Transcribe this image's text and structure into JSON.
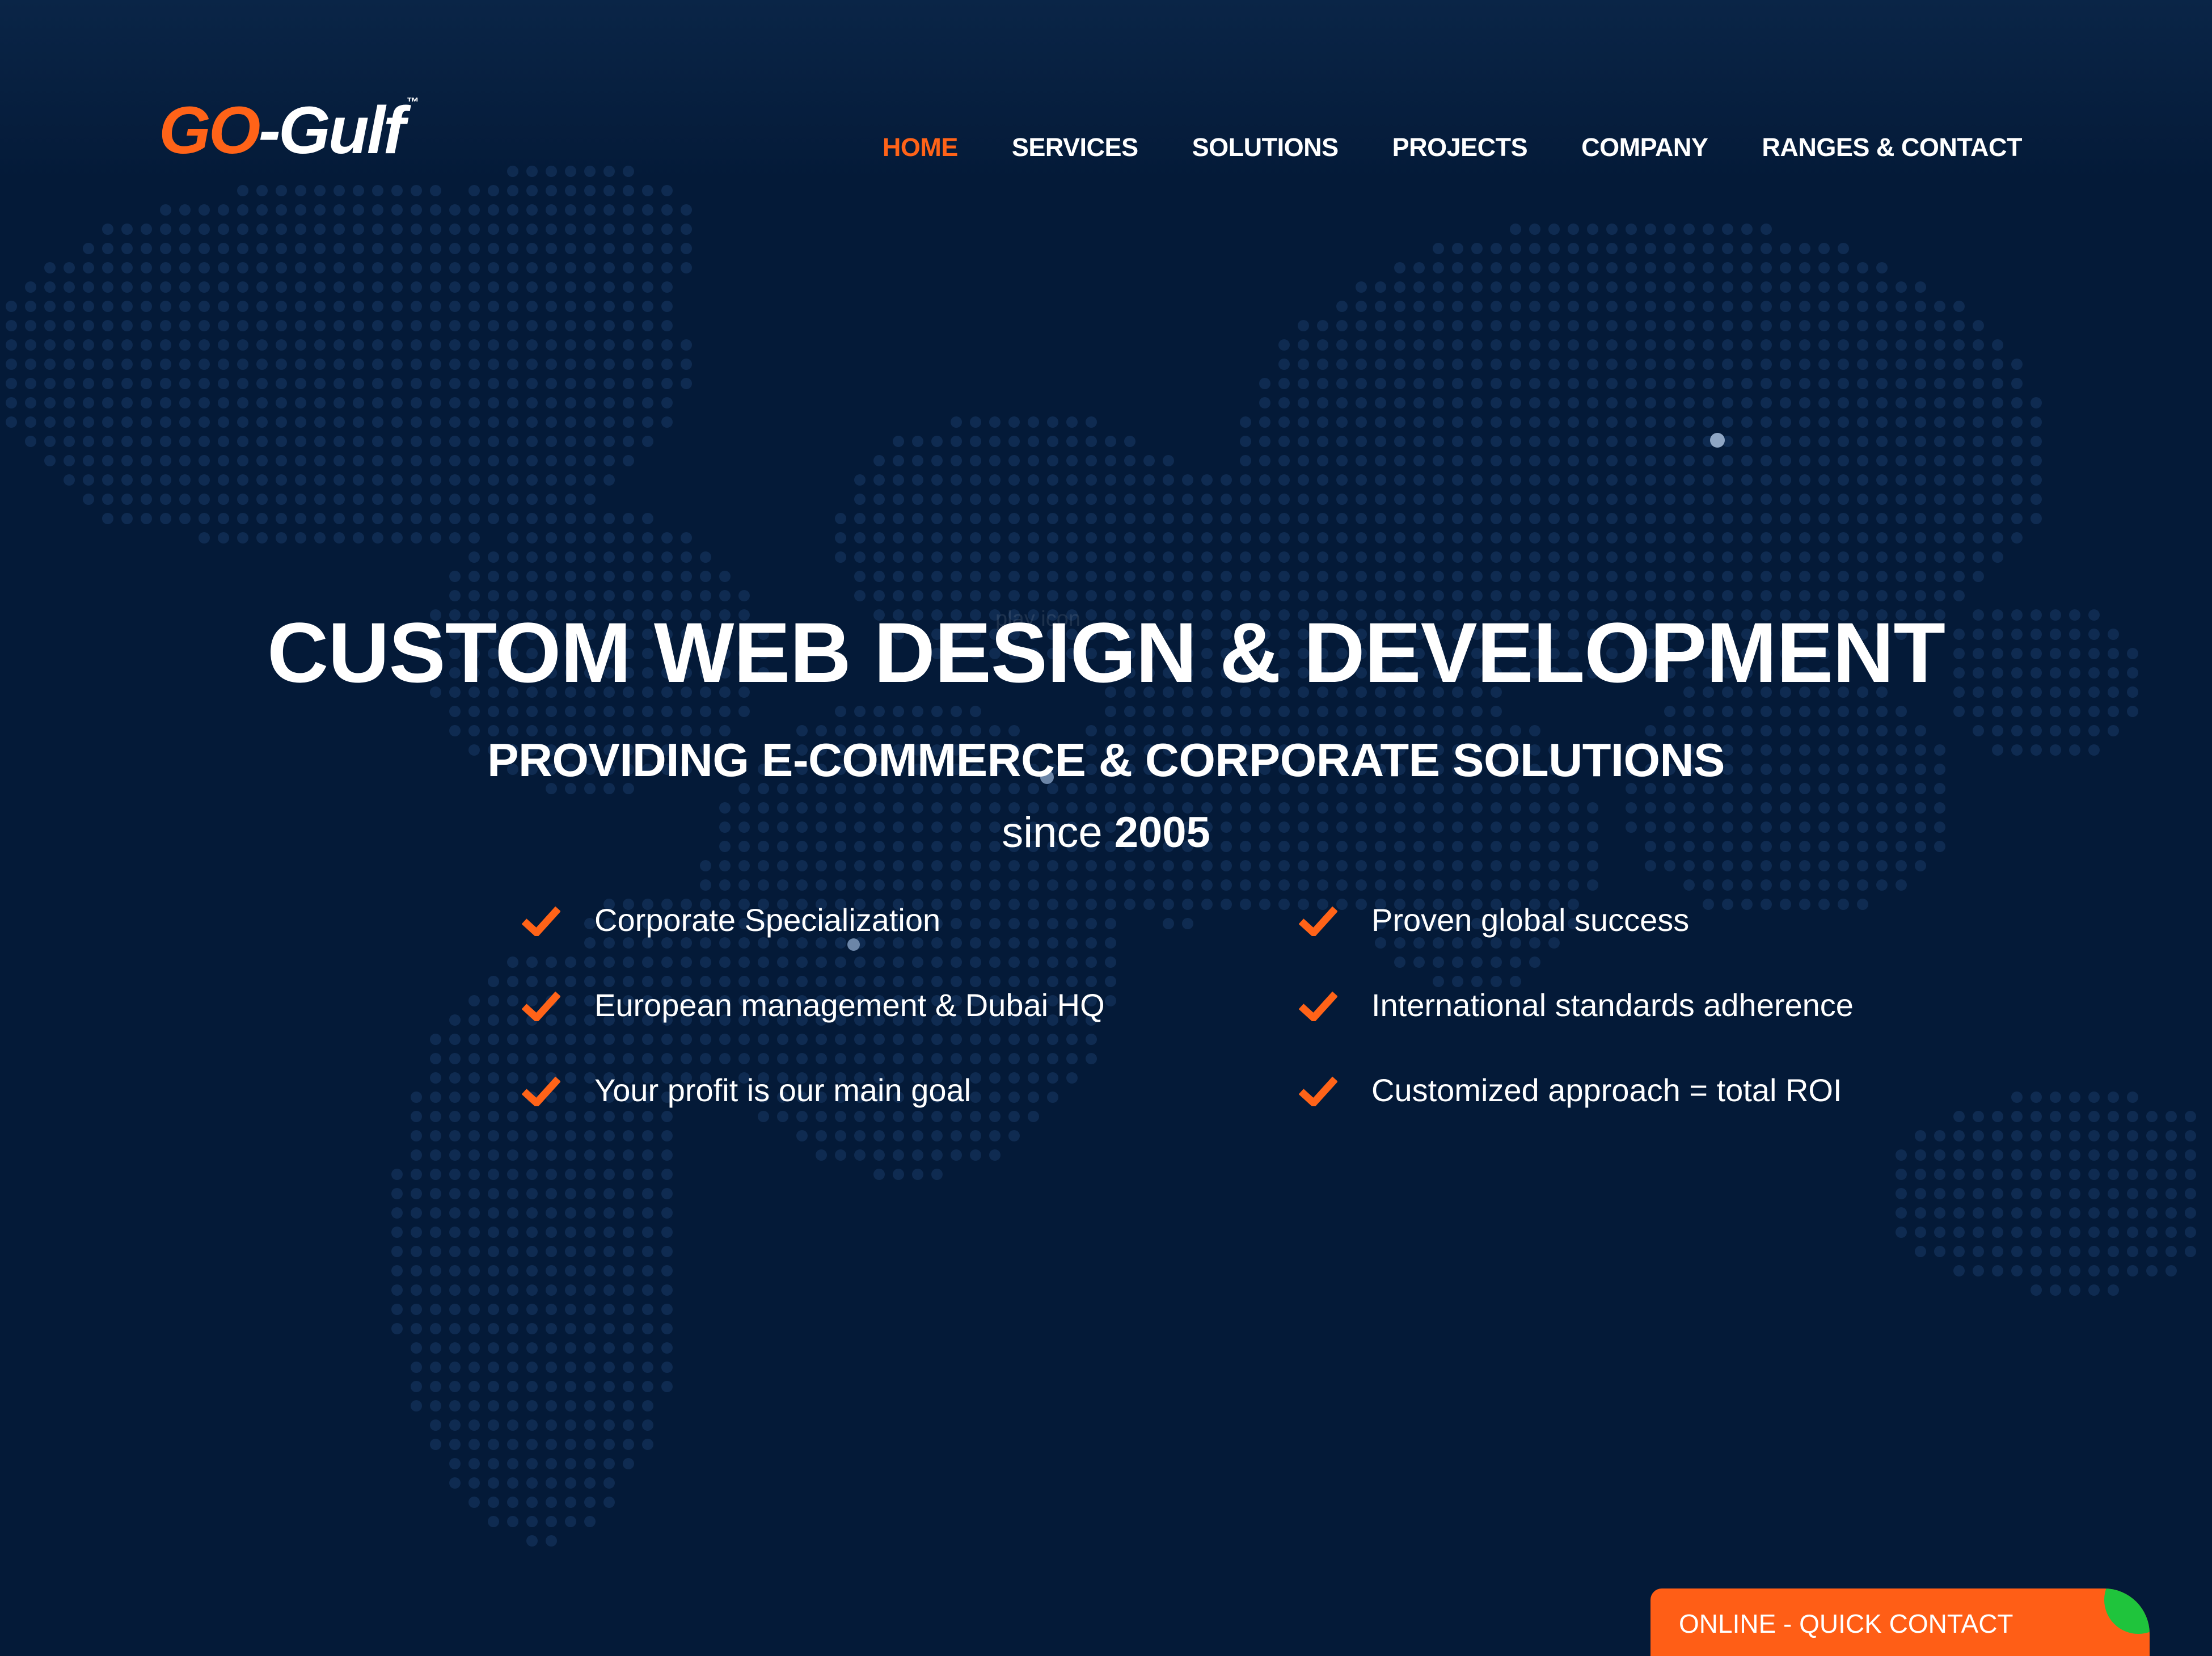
{
  "brand": {
    "logo_go": "GO",
    "logo_dash": "-",
    "logo_gulf": "Gulf",
    "logo_tm": "™"
  },
  "nav": {
    "items": [
      {
        "label": "HOME",
        "active": true
      },
      {
        "label": "SERVICES"
      },
      {
        "label": "SOLUTIONS"
      },
      {
        "label": "PROJECTS"
      },
      {
        "label": "COMPANY"
      },
      {
        "label": "RANGES & CONTACT"
      }
    ]
  },
  "hero": {
    "play_icon_text": "play icon",
    "title": "CUSTOM WEB DESIGN & DEVELOPMENT",
    "subtitle": "PROVIDING E-COMMERCE & CORPORATE SOLUTIONS",
    "since_label": "since",
    "since_year": "2005"
  },
  "features": [
    "Corporate Specialization",
    "Proven global success",
    "European management & Dubai HQ",
    "International standards adherence",
    "Your profit is our main goal",
    "Customized approach = total ROI"
  ],
  "quick_contact": {
    "label": "ONLINE - QUICK CONTACT",
    "status": "online"
  },
  "colors": {
    "background": "#041a38",
    "accent": "#ff6318",
    "online": "#1fc43c",
    "map_dot": "#1a3a66"
  }
}
